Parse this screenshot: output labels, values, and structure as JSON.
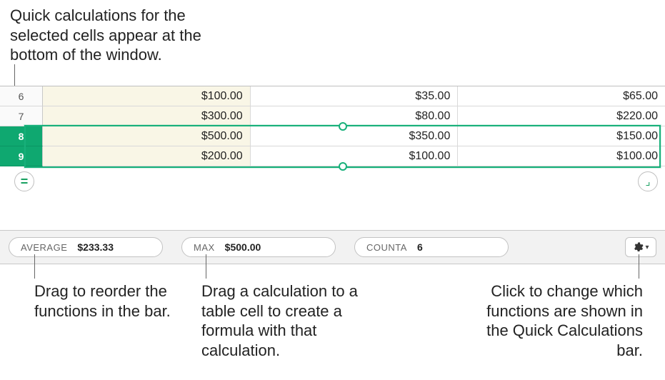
{
  "callouts": {
    "top": "Quick calculations for the selected cells appear at the bottom of the window.",
    "bottom_left": "Drag to reorder the functions in the bar.",
    "bottom_mid": "Drag a calculation to a table cell to create a formula with that calculation.",
    "bottom_right": "Click to change which functions are shown in the Quick Calculations bar."
  },
  "rows": [
    {
      "num": "6",
      "selected": false,
      "cells": [
        "$100.00",
        "$35.00",
        "$65.00"
      ]
    },
    {
      "num": "7",
      "selected": false,
      "cells": [
        "$300.00",
        "$80.00",
        "$220.00"
      ]
    },
    {
      "num": "8",
      "selected": true,
      "cells": [
        "$500.00",
        "$350.00",
        "$150.00"
      ]
    },
    {
      "num": "9",
      "selected": true,
      "cells": [
        "$200.00",
        "$100.00",
        "$100.00"
      ]
    }
  ],
  "calc_bar": {
    "pills": [
      {
        "fn": "AVERAGE",
        "val": "$233.33"
      },
      {
        "fn": "MAX",
        "val": "$500.00"
      },
      {
        "fn": "COUNTA",
        "val": "6"
      }
    ]
  },
  "icons": {
    "equals": "=",
    "table_corner": "⌟"
  }
}
